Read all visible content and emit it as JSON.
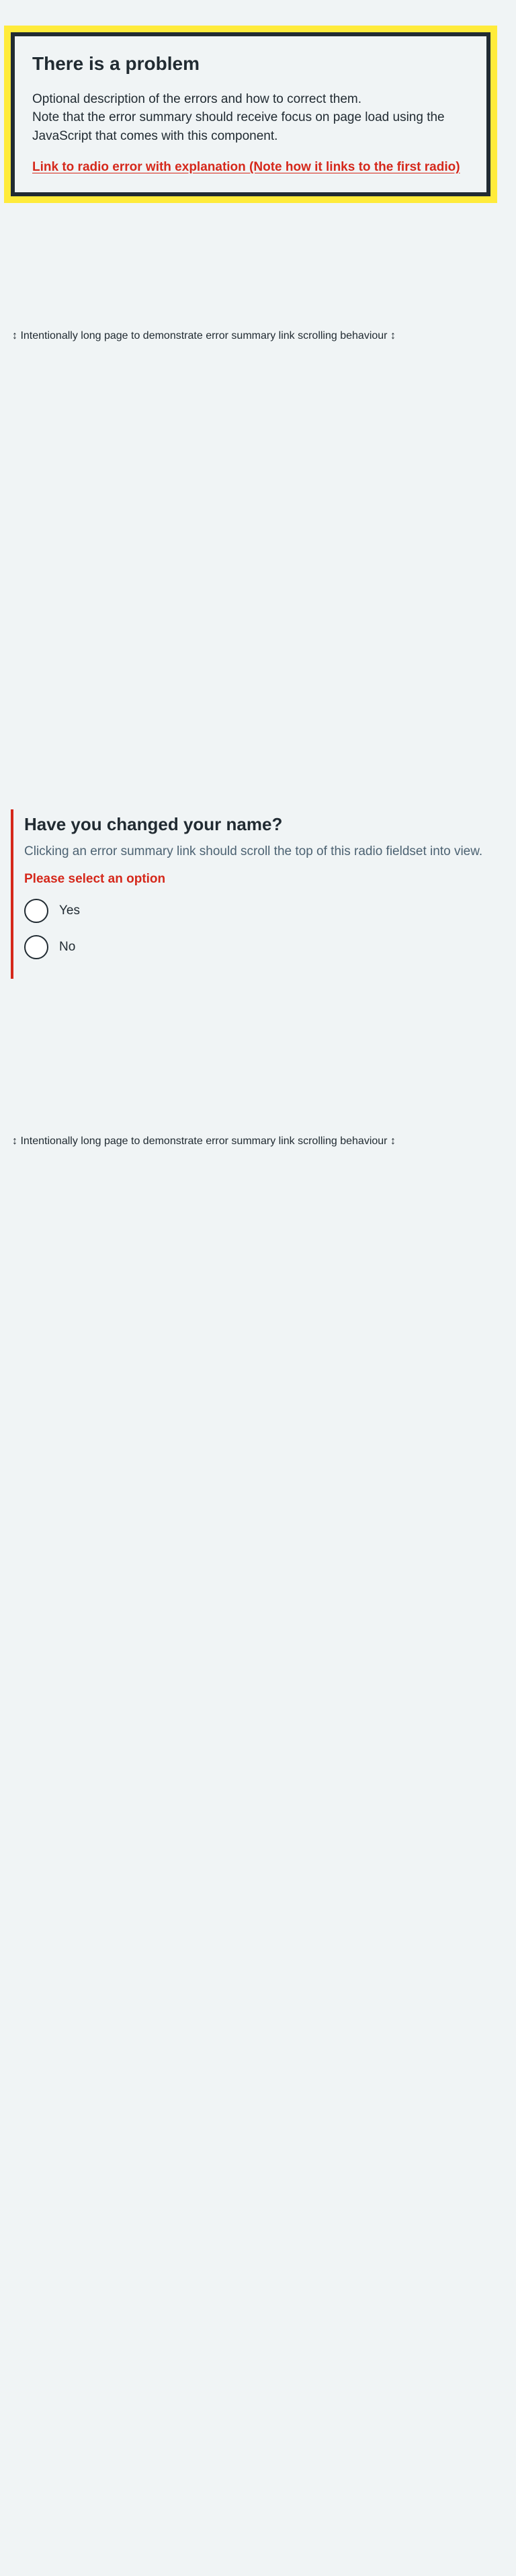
{
  "error_summary": {
    "title": "There is a problem",
    "description_line1": "Optional description of the errors and how to correct them.",
    "description_line2": "Note that the error summary should receive focus on page load using the JavaScript that comes with this component.",
    "link_text": "Link to radio error with explanation (Note how it links to the first radio)",
    "border_color": "#212b32",
    "highlight_color": "#ffeb3b",
    "link_color": "#d5281b"
  },
  "spacer_note": "↕ Intentionally long page to demonstrate error summary link scrolling behaviour ↕",
  "radio_group": {
    "legend": "Have you changed your name?",
    "hint": "Clicking an error summary link should scroll the top of this radio fieldset into view.",
    "error_message": "Please select an option",
    "options": [
      {
        "label": "Yes"
      },
      {
        "label": "No"
      }
    ],
    "error_color": "#d5281b"
  }
}
